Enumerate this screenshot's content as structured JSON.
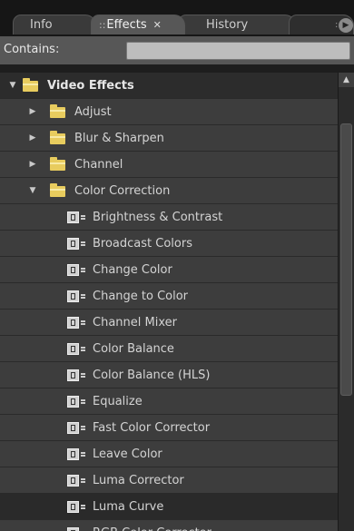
{
  "tabs": [
    {
      "label": "Info"
    },
    {
      "label": "Effects",
      "close": "✕",
      "grip": "::"
    },
    {
      "label": "History"
    },
    {
      "grip": "::",
      "more": "▶"
    }
  ],
  "contains": {
    "label": "Contains:",
    "value": "",
    "placeholder": ""
  },
  "tree": {
    "root": {
      "label": "Video Effects",
      "expanded": true
    },
    "folders": [
      {
        "label": "Adjust",
        "expanded": false
      },
      {
        "label": "Blur & Sharpen",
        "expanded": false
      },
      {
        "label": "Channel",
        "expanded": false
      },
      {
        "label": "Color Correction",
        "expanded": true
      }
    ],
    "effects": [
      {
        "label": "Brightness & Contrast"
      },
      {
        "label": "Broadcast Colors"
      },
      {
        "label": "Change Color"
      },
      {
        "label": "Change to Color"
      },
      {
        "label": "Channel Mixer"
      },
      {
        "label": "Color Balance"
      },
      {
        "label": "Color Balance (HLS)"
      },
      {
        "label": "Equalize"
      },
      {
        "label": "Fast Color Corrector"
      },
      {
        "label": "Leave Color"
      },
      {
        "label": "Luma Corrector"
      },
      {
        "label": "Luma Curve",
        "selected": true
      },
      {
        "label": "RGB Color Corrector"
      }
    ]
  },
  "icons": {
    "expanded": "▼",
    "collapsed": "▶",
    "scroll_up": "▲"
  },
  "colors": {
    "folder": "#e8cc5e",
    "row": "#3d3d3d",
    "selected_row": "#2a2a2a",
    "header": "#575757"
  }
}
